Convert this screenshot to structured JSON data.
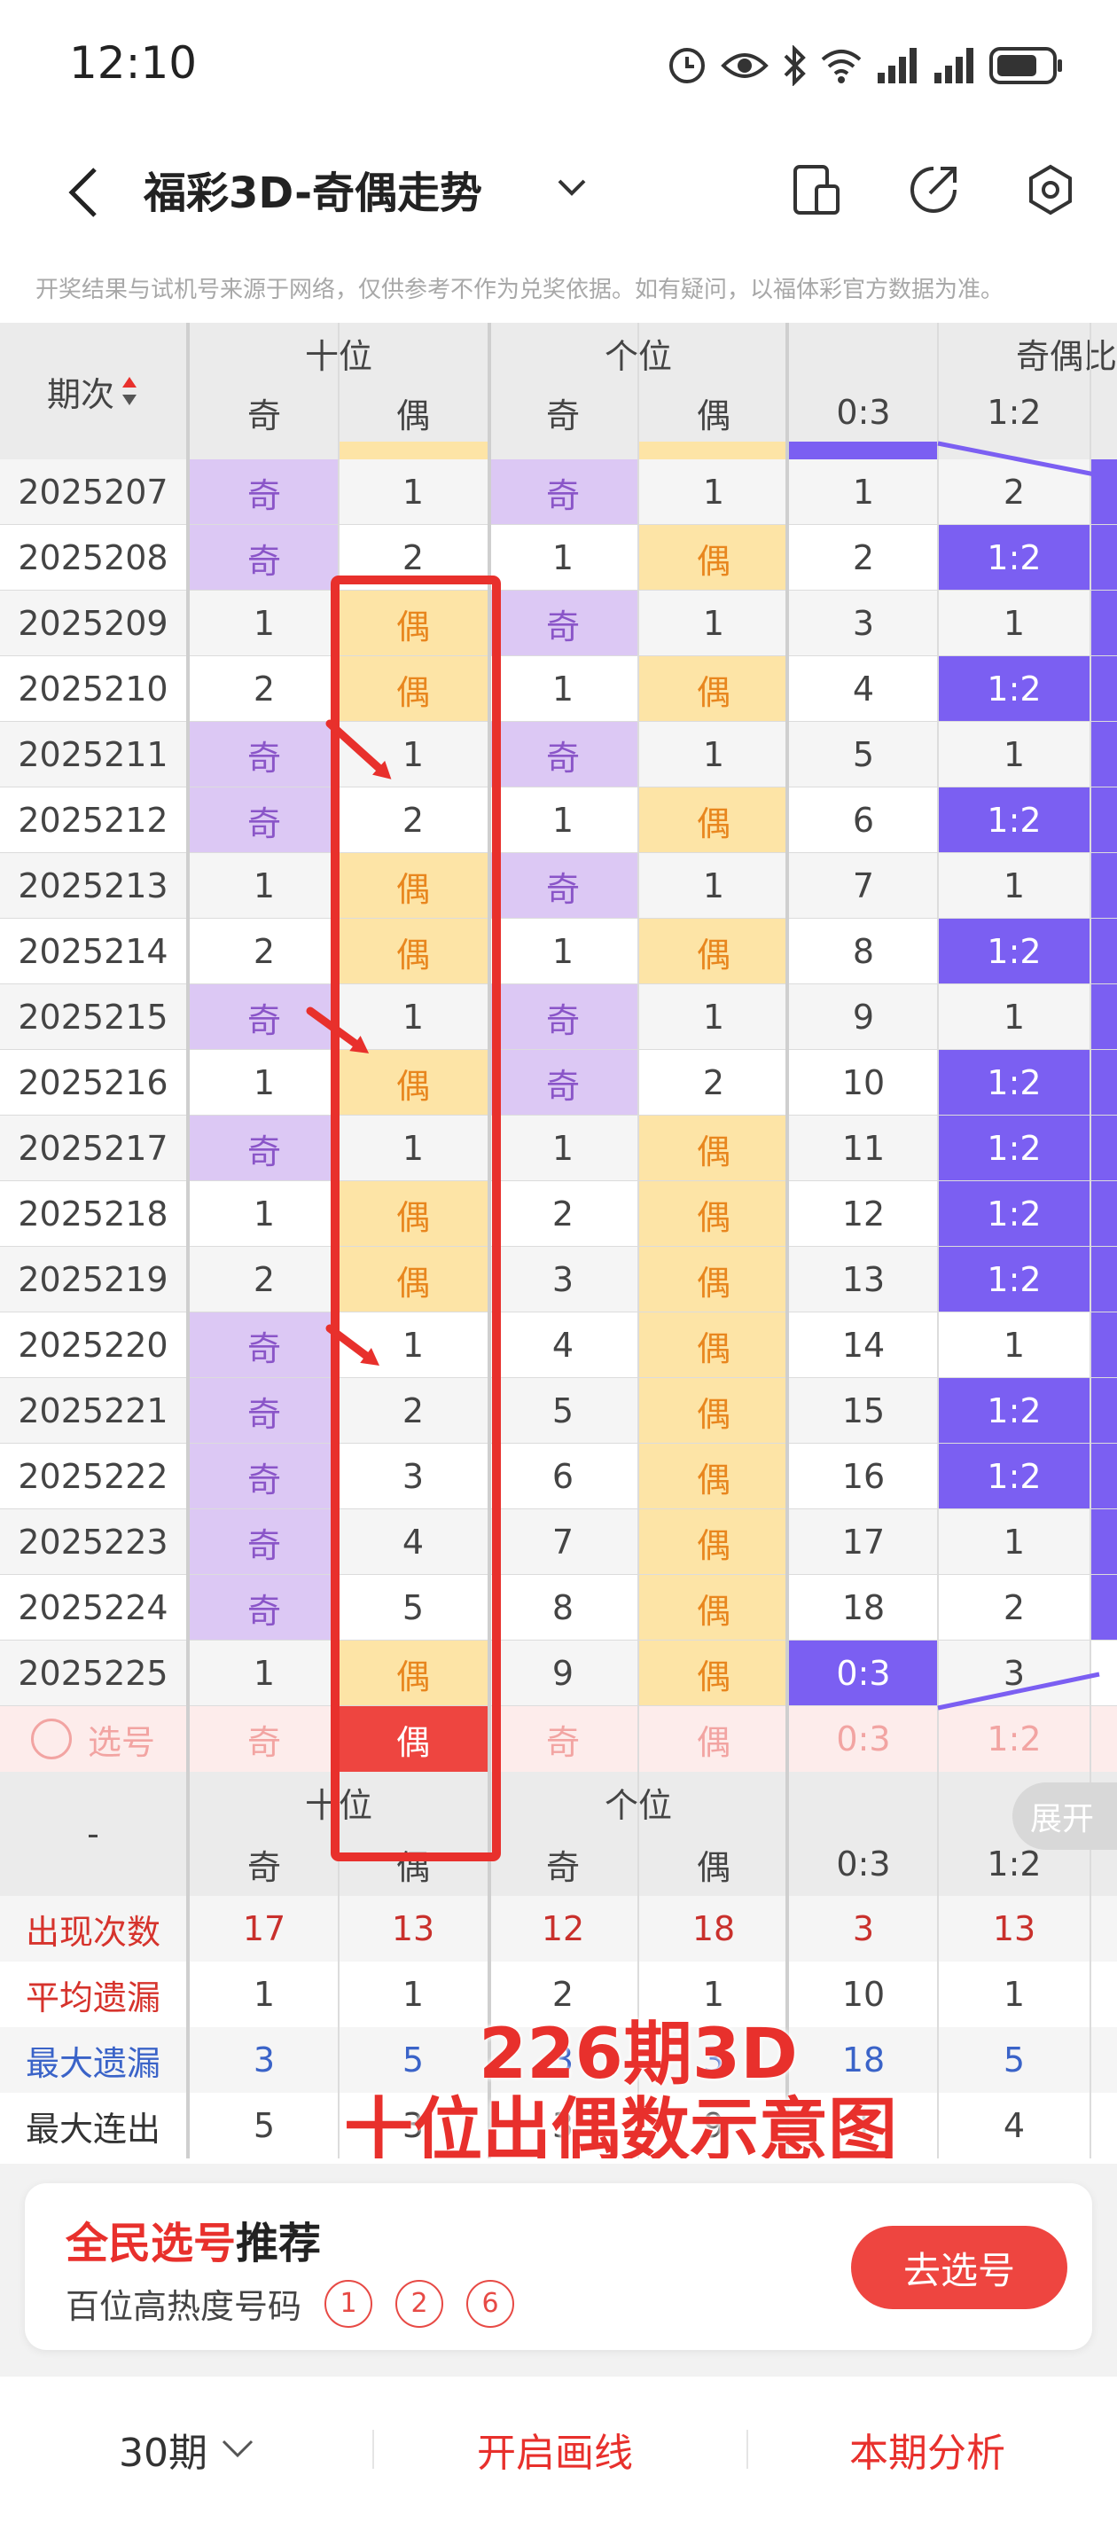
{
  "status_bar": {
    "time": "12:10"
  },
  "header": {
    "title": "福彩3D-奇偶走势"
  },
  "disclaimer": "开奖结果与试机号来源于网络，仅供参考不作为兑奖依据。如有疑问，以福体彩官方数据为准。",
  "table": {
    "period_header": "期次",
    "group_headers": [
      "十位",
      "个位",
      "奇偶比"
    ],
    "sub_headers": [
      "奇",
      "偶",
      "奇",
      "偶",
      "0:3",
      "1:2"
    ],
    "rows": [
      {
        "p": "2025207",
        "t": [
          "奇",
          "1"
        ],
        "u": [
          "奇",
          "1"
        ],
        "r": [
          "1",
          "2"
        ]
      },
      {
        "p": "2025208",
        "t": [
          "奇",
          "2"
        ],
        "u": [
          "1",
          "偶"
        ],
        "r": [
          "2",
          "1:2"
        ]
      },
      {
        "p": "2025209",
        "t": [
          "1",
          "偶"
        ],
        "u": [
          "奇",
          "1"
        ],
        "r": [
          "3",
          "1"
        ]
      },
      {
        "p": "2025210",
        "t": [
          "2",
          "偶"
        ],
        "u": [
          "1",
          "偶"
        ],
        "r": [
          "4",
          "1:2"
        ]
      },
      {
        "p": "2025211",
        "t": [
          "奇",
          "1"
        ],
        "u": [
          "奇",
          "1"
        ],
        "r": [
          "5",
          "1"
        ]
      },
      {
        "p": "2025212",
        "t": [
          "奇",
          "2"
        ],
        "u": [
          "1",
          "偶"
        ],
        "r": [
          "6",
          "1:2"
        ]
      },
      {
        "p": "2025213",
        "t": [
          "1",
          "偶"
        ],
        "u": [
          "奇",
          "1"
        ],
        "r": [
          "7",
          "1"
        ]
      },
      {
        "p": "2025214",
        "t": [
          "2",
          "偶"
        ],
        "u": [
          "1",
          "偶"
        ],
        "r": [
          "8",
          "1:2"
        ]
      },
      {
        "p": "2025215",
        "t": [
          "奇",
          "1"
        ],
        "u": [
          "奇",
          "1"
        ],
        "r": [
          "9",
          "1"
        ]
      },
      {
        "p": "2025216",
        "t": [
          "1",
          "偶"
        ],
        "u": [
          "奇",
          "2"
        ],
        "r": [
          "10",
          "1:2"
        ]
      },
      {
        "p": "2025217",
        "t": [
          "奇",
          "1"
        ],
        "u": [
          "1",
          "偶"
        ],
        "r": [
          "11",
          "1:2"
        ]
      },
      {
        "p": "2025218",
        "t": [
          "1",
          "偶"
        ],
        "u": [
          "2",
          "偶"
        ],
        "r": [
          "12",
          "1:2"
        ]
      },
      {
        "p": "2025219",
        "t": [
          "2",
          "偶"
        ],
        "u": [
          "3",
          "偶"
        ],
        "r": [
          "13",
          "1:2"
        ]
      },
      {
        "p": "2025220",
        "t": [
          "奇",
          "1"
        ],
        "u": [
          "4",
          "偶"
        ],
        "r": [
          "14",
          "1"
        ]
      },
      {
        "p": "2025221",
        "t": [
          "奇",
          "2"
        ],
        "u": [
          "5",
          "偶"
        ],
        "r": [
          "15",
          "1:2"
        ]
      },
      {
        "p": "2025222",
        "t": [
          "奇",
          "3"
        ],
        "u": [
          "6",
          "偶"
        ],
        "r": [
          "16",
          "1:2"
        ]
      },
      {
        "p": "2025223",
        "t": [
          "奇",
          "4"
        ],
        "u": [
          "7",
          "偶"
        ],
        "r": [
          "17",
          "1"
        ]
      },
      {
        "p": "2025224",
        "t": [
          "奇",
          "5"
        ],
        "u": [
          "8",
          "偶"
        ],
        "r": [
          "18",
          "2"
        ]
      },
      {
        "p": "2025225",
        "t": [
          "1",
          "偶"
        ],
        "u": [
          "9",
          "偶"
        ],
        "r": [
          "0:3",
          "3"
        ]
      }
    ],
    "select_row": {
      "label": "选号",
      "values": [
        "奇",
        "偶",
        "奇",
        "偶",
        "0:3",
        "1:2"
      ]
    },
    "footer_group_headers": [
      "十位",
      "个位"
    ],
    "footer_dash": "-",
    "stats": [
      {
        "label": "出现次数",
        "values": [
          "17",
          "13",
          "12",
          "18",
          "3",
          "13"
        ]
      },
      {
        "label": "平均遗漏",
        "values": [
          "1",
          "1",
          "2",
          "1",
          "10",
          "1"
        ]
      },
      {
        "label": "最大遗漏",
        "values": [
          "3",
          "5",
          "3",
          "3",
          "18",
          "5"
        ]
      },
      {
        "label": "最大连出",
        "values": [
          "5",
          "3",
          "3",
          "9",
          "1",
          "4"
        ]
      }
    ],
    "expand_label": "展开"
  },
  "annotation": {
    "line1": "226期3D",
    "line2": "十位出偶数示意图"
  },
  "recommend": {
    "title_red": "全民选号",
    "title_dark": "推荐",
    "subtitle": "百位高热度号码",
    "numbers": [
      "1",
      "2",
      "6"
    ],
    "button": "去选号"
  },
  "bottom_bar": {
    "periods": "30期",
    "draw_lines": "开启画线",
    "analysis": "本期分析"
  },
  "colors": {
    "odd_bg": "#dcc8f4",
    "even_bg": "#fde4a6",
    "ratio_bg": "#7b5ff2",
    "annotation_red": "#e8302c",
    "selected_even_bg": "#ee4540"
  }
}
